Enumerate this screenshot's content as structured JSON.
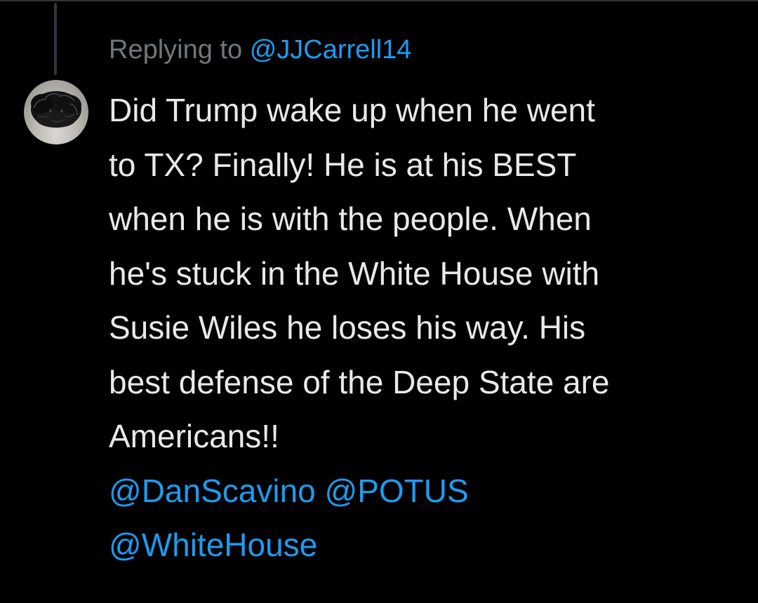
{
  "reply_context": {
    "prefix": "Replying to",
    "handle": "@JJCarrell14"
  },
  "avatar": {
    "icon": "profile-photo-dog-icon"
  },
  "tweet": {
    "lines": [
      "Did Trump wake up when he went",
      "to TX? Finally! He is at his BEST",
      "when he is with the people. When",
      "he's stuck in the White House with",
      "Susie Wiles he loses his way. His",
      "best defense of the Deep State are",
      "Americans!!"
    ],
    "mentions": [
      "@DanScavino",
      "@POTUS",
      "@WhiteHouse"
    ]
  },
  "colors": {
    "background": "#000000",
    "text": "#e7e9ea",
    "secondary_text": "#71767b",
    "link": "#1d9bf0",
    "thread_line": "#333639"
  }
}
